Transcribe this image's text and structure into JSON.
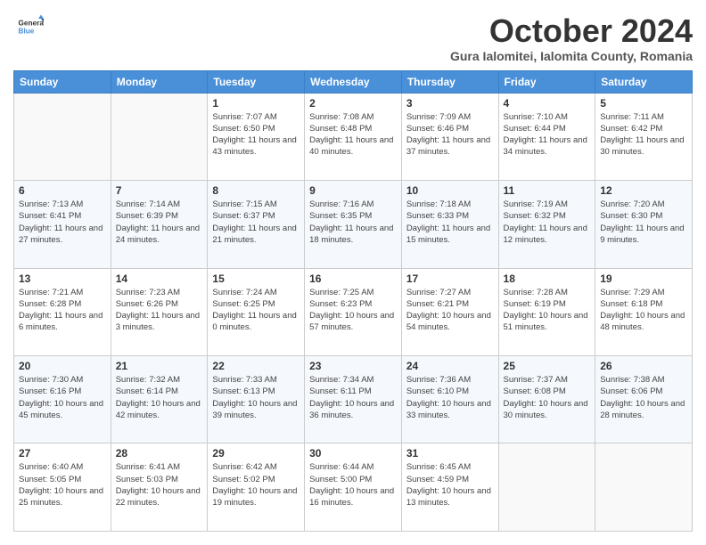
{
  "header": {
    "logo": {
      "line1": "General",
      "line2": "Blue"
    },
    "title": "October 2024",
    "subtitle": "Gura Ialomitei, Ialomita County, Romania"
  },
  "columns": [
    "Sunday",
    "Monday",
    "Tuesday",
    "Wednesday",
    "Thursday",
    "Friday",
    "Saturday"
  ],
  "weeks": [
    [
      {
        "day": "",
        "info": ""
      },
      {
        "day": "",
        "info": ""
      },
      {
        "day": "1",
        "info": "Sunrise: 7:07 AM\nSunset: 6:50 PM\nDaylight: 11 hours and 43 minutes."
      },
      {
        "day": "2",
        "info": "Sunrise: 7:08 AM\nSunset: 6:48 PM\nDaylight: 11 hours and 40 minutes."
      },
      {
        "day": "3",
        "info": "Sunrise: 7:09 AM\nSunset: 6:46 PM\nDaylight: 11 hours and 37 minutes."
      },
      {
        "day": "4",
        "info": "Sunrise: 7:10 AM\nSunset: 6:44 PM\nDaylight: 11 hours and 34 minutes."
      },
      {
        "day": "5",
        "info": "Sunrise: 7:11 AM\nSunset: 6:42 PM\nDaylight: 11 hours and 30 minutes."
      }
    ],
    [
      {
        "day": "6",
        "info": "Sunrise: 7:13 AM\nSunset: 6:41 PM\nDaylight: 11 hours and 27 minutes."
      },
      {
        "day": "7",
        "info": "Sunrise: 7:14 AM\nSunset: 6:39 PM\nDaylight: 11 hours and 24 minutes."
      },
      {
        "day": "8",
        "info": "Sunrise: 7:15 AM\nSunset: 6:37 PM\nDaylight: 11 hours and 21 minutes."
      },
      {
        "day": "9",
        "info": "Sunrise: 7:16 AM\nSunset: 6:35 PM\nDaylight: 11 hours and 18 minutes."
      },
      {
        "day": "10",
        "info": "Sunrise: 7:18 AM\nSunset: 6:33 PM\nDaylight: 11 hours and 15 minutes."
      },
      {
        "day": "11",
        "info": "Sunrise: 7:19 AM\nSunset: 6:32 PM\nDaylight: 11 hours and 12 minutes."
      },
      {
        "day": "12",
        "info": "Sunrise: 7:20 AM\nSunset: 6:30 PM\nDaylight: 11 hours and 9 minutes."
      }
    ],
    [
      {
        "day": "13",
        "info": "Sunrise: 7:21 AM\nSunset: 6:28 PM\nDaylight: 11 hours and 6 minutes."
      },
      {
        "day": "14",
        "info": "Sunrise: 7:23 AM\nSunset: 6:26 PM\nDaylight: 11 hours and 3 minutes."
      },
      {
        "day": "15",
        "info": "Sunrise: 7:24 AM\nSunset: 6:25 PM\nDaylight: 11 hours and 0 minutes."
      },
      {
        "day": "16",
        "info": "Sunrise: 7:25 AM\nSunset: 6:23 PM\nDaylight: 10 hours and 57 minutes."
      },
      {
        "day": "17",
        "info": "Sunrise: 7:27 AM\nSunset: 6:21 PM\nDaylight: 10 hours and 54 minutes."
      },
      {
        "day": "18",
        "info": "Sunrise: 7:28 AM\nSunset: 6:19 PM\nDaylight: 10 hours and 51 minutes."
      },
      {
        "day": "19",
        "info": "Sunrise: 7:29 AM\nSunset: 6:18 PM\nDaylight: 10 hours and 48 minutes."
      }
    ],
    [
      {
        "day": "20",
        "info": "Sunrise: 7:30 AM\nSunset: 6:16 PM\nDaylight: 10 hours and 45 minutes."
      },
      {
        "day": "21",
        "info": "Sunrise: 7:32 AM\nSunset: 6:14 PM\nDaylight: 10 hours and 42 minutes."
      },
      {
        "day": "22",
        "info": "Sunrise: 7:33 AM\nSunset: 6:13 PM\nDaylight: 10 hours and 39 minutes."
      },
      {
        "day": "23",
        "info": "Sunrise: 7:34 AM\nSunset: 6:11 PM\nDaylight: 10 hours and 36 minutes."
      },
      {
        "day": "24",
        "info": "Sunrise: 7:36 AM\nSunset: 6:10 PM\nDaylight: 10 hours and 33 minutes."
      },
      {
        "day": "25",
        "info": "Sunrise: 7:37 AM\nSunset: 6:08 PM\nDaylight: 10 hours and 30 minutes."
      },
      {
        "day": "26",
        "info": "Sunrise: 7:38 AM\nSunset: 6:06 PM\nDaylight: 10 hours and 28 minutes."
      }
    ],
    [
      {
        "day": "27",
        "info": "Sunrise: 6:40 AM\nSunset: 5:05 PM\nDaylight: 10 hours and 25 minutes."
      },
      {
        "day": "28",
        "info": "Sunrise: 6:41 AM\nSunset: 5:03 PM\nDaylight: 10 hours and 22 minutes."
      },
      {
        "day": "29",
        "info": "Sunrise: 6:42 AM\nSunset: 5:02 PM\nDaylight: 10 hours and 19 minutes."
      },
      {
        "day": "30",
        "info": "Sunrise: 6:44 AM\nSunset: 5:00 PM\nDaylight: 10 hours and 16 minutes."
      },
      {
        "day": "31",
        "info": "Sunrise: 6:45 AM\nSunset: 4:59 PM\nDaylight: 10 hours and 13 minutes."
      },
      {
        "day": "",
        "info": ""
      },
      {
        "day": "",
        "info": ""
      }
    ]
  ]
}
